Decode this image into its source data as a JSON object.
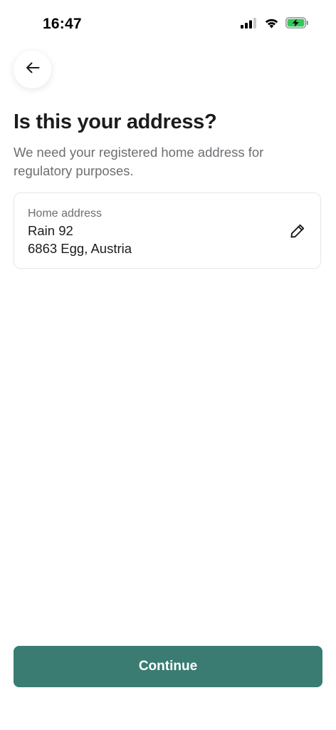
{
  "status_bar": {
    "time": "16:47",
    "icons": [
      "cellular-signal-icon",
      "wifi-icon",
      "battery-charging-icon"
    ],
    "battery_color": "#34c759"
  },
  "header": {
    "back_icon": "arrow-left-icon"
  },
  "main": {
    "title": "Is this your address?",
    "subtitle": "We need your registered home address for regulatory purposes.",
    "address_card": {
      "label": "Home address",
      "line1": "Rain 92",
      "line2": "6863 Egg, Austria",
      "edit_icon": "pencil-icon"
    }
  },
  "footer": {
    "continue_label": "Continue",
    "accent_color": "#3a7c72"
  }
}
